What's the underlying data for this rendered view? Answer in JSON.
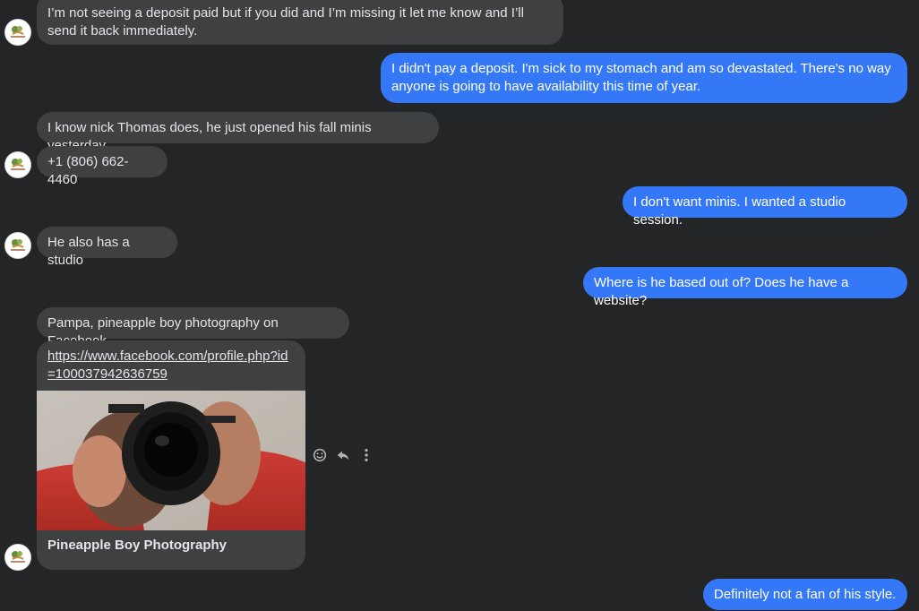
{
  "messages": [
    {
      "text": "I’m not seeing a deposit paid but if you did and I’m missing it let me know and I’ll send it back immediately."
    },
    {
      "text": "I didn't pay a deposit. I'm sick to my stomach and am so devastated. There's no way anyone is going to have availability this time of year."
    },
    {
      "text": "I know nick Thomas does, he just opened his fall minis yesterday"
    },
    {
      "text": "+1 (806) 662-4460"
    },
    {
      "text": "I don't want minis. I wanted a studio session."
    },
    {
      "text": "He also has a studio"
    },
    {
      "text": "Where is he based out of? Does he have a website?"
    },
    {
      "text": "Pampa, pineapple boy photography on Facebook"
    },
    {
      "text": "Definitely not a fan of his style."
    }
  ],
  "link_preview": {
    "url": "https://www.facebook.com/profile.php?id=100037942636759",
    "title": "Pineapple Boy Photography"
  },
  "icons": [
    "avatar",
    "emoji-icon",
    "reply-icon",
    "more-icon"
  ],
  "colors": {
    "background": "#242526",
    "incoming_bubble": "#3e4042",
    "outgoing_bubble": "#3578f7",
    "incoming_text": "#e4e6eb",
    "outgoing_text": "#ffffff"
  }
}
